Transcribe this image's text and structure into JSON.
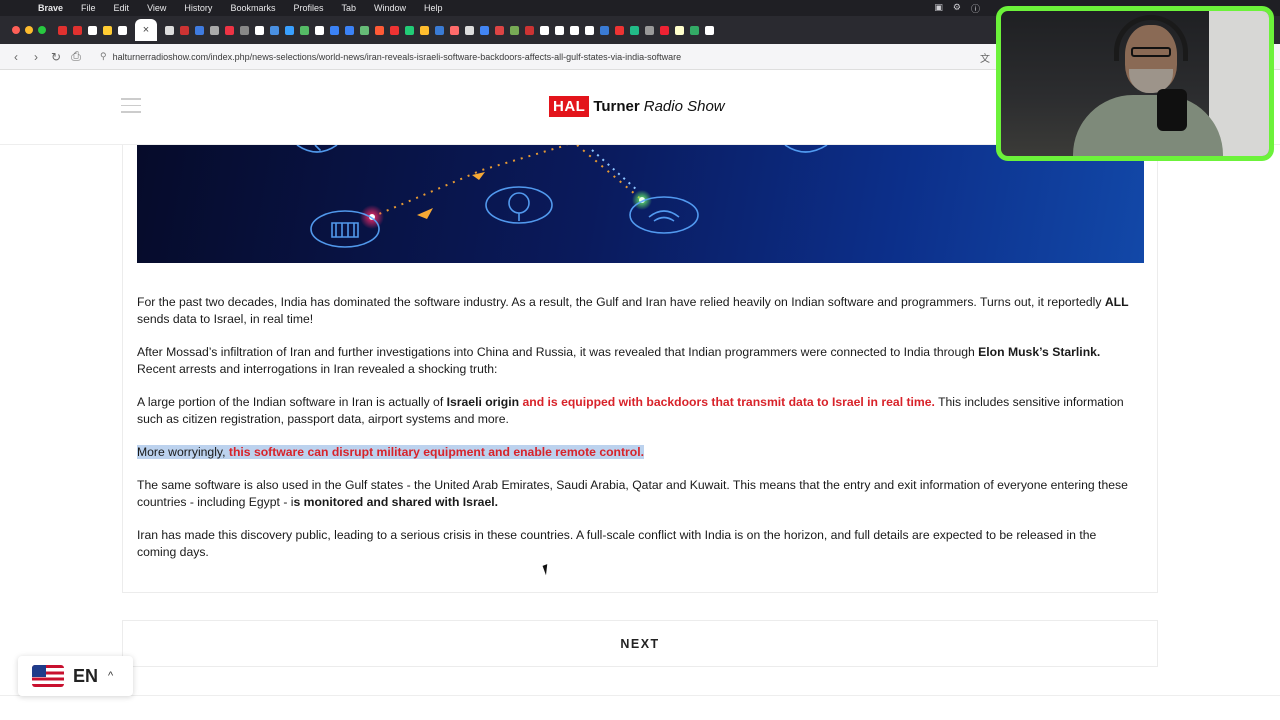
{
  "menubar": {
    "items": [
      "Brave",
      "File",
      "Edit",
      "View",
      "History",
      "Bookmarks",
      "Profiles",
      "Tab",
      "Window",
      "Help"
    ]
  },
  "browser": {
    "url": "halturnerradioshow.com/index.php/news-selections/world-news/iran-reveals-israeli-software-backdoors-affects-all-gulf-states-via-india-software"
  },
  "site": {
    "logo_hal": "HAL",
    "logo_turner": "Turner",
    "logo_radio": "Radio Show"
  },
  "article": {
    "p1_a": "For the past two decades, India has dominated the software industry. As a result, the Gulf and Iran have relied heavily on Indian software and programmers.  Turns out, it reportedly ",
    "p1_b": "ALL",
    "p1_c": " sends data to Israel, in real time!",
    "p2_a": "After Mossad’s infiltration of Iran and further investigations into China and Russia, it was revealed that Indian programmers were connected to India through ",
    "p2_b": "Elon Musk’s Starlink.",
    "p2_c": " Recent arrests and interrogations in Iran revealed a shocking truth:",
    "p3_a": "A large portion of the Indian software in Iran is actually of ",
    "p3_b": "Israeli origin",
    "p3_c": " and is equipped with backdoors that transmit data to Israel in real time.",
    "p3_d": " This includes sensitive information such as citizen registration, passport data, airport systems and more.",
    "p4_a": "More worryingly, ",
    "p4_b": "this software can disrupt military equipment and enable remote control.",
    "p5_a": "The same software is also used in the Gulf states - the United Arab Emirates, Saudi Arabia, Qatar and Kuwait. This means that the entry and exit information of everyone entering these countries - including Egypt - i",
    "p5_b": "s monitored and shared with Israel.",
    "p6": "Iran has made this discovery public, leading to a serious crisis in these countries. A full-scale conflict with India is on the horizon, and full details are expected to be released in the coming days."
  },
  "pager": {
    "next_label": "NEXT"
  },
  "language": {
    "code": "EN"
  },
  "colors": {
    "accent_red": "#d8232a",
    "logo_red": "#e3141b",
    "webcam_border": "#6cf23a"
  }
}
